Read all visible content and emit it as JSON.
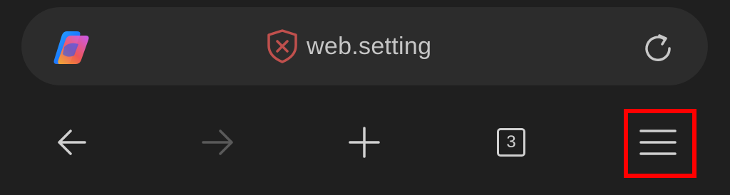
{
  "address_bar": {
    "url": "web.setting",
    "security_icon": "shield-x-icon",
    "left_icon": "copilot-icon",
    "right_icon": "reload-icon"
  },
  "toolbar": {
    "back_icon": "back-arrow-icon",
    "forward_icon": "forward-arrow-icon",
    "new_tab_icon": "plus-icon",
    "tab_count": "3",
    "menu_icon": "hamburger-menu-icon"
  },
  "colors": {
    "background": "#1f1f1f",
    "address_bar": "#2c2c2c",
    "icon": "#d0d0d0",
    "disabled_icon": "#5a5a5a",
    "security_warning": "#c0504d",
    "highlight": "#ff0000"
  }
}
